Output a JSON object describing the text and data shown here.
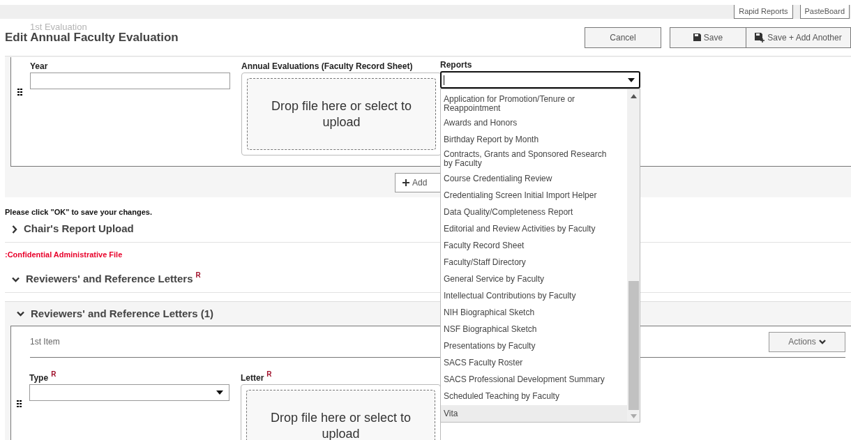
{
  "top_bar": {
    "buttons": [
      "Rapid Reports",
      "PasteBoard"
    ]
  },
  "header": {
    "behind_title": "1st Evaluation",
    "title": "Edit Annual Faculty Evaluation",
    "buttons": [
      {
        "label": "Cancel",
        "kind": "plain"
      },
      {
        "label": "Save",
        "kind": "save"
      },
      {
        "label": "Save + Add Another",
        "kind": "save-add"
      }
    ]
  },
  "evaluation": {
    "fields": [
      {
        "label": "Year",
        "kind": "text"
      },
      {
        "label": "Annual Evaluations (Faculty Record Sheet)",
        "kind": "file",
        "drop_text": "Drop file here or select to upload"
      }
    ],
    "add_button": "Add"
  },
  "reports": {
    "label": "Reports",
    "options": [
      {
        "label": "Application for Promotion/Tenure or Reappointment",
        "selected": false
      },
      {
        "label": "Awards and Honors",
        "selected": false
      },
      {
        "label": "Birthday Report by Month",
        "selected": false
      },
      {
        "label": "Contracts, Grants and Sponsored Research by Faculty",
        "selected": false
      },
      {
        "label": "Course Credentialing Review",
        "selected": false
      },
      {
        "label": "Credentialing Screen Initial Import Helper",
        "selected": false
      },
      {
        "label": "Data Quality/Completeness Report",
        "selected": false
      },
      {
        "label": "Editorial and Review Activities by Faculty",
        "selected": false
      },
      {
        "label": "Faculty Record Sheet",
        "selected": false
      },
      {
        "label": "Faculty/Staff Directory",
        "selected": false
      },
      {
        "label": "General Service by Faculty",
        "selected": false
      },
      {
        "label": "Intellectual Contributions by Faculty",
        "selected": false
      },
      {
        "label": "NIH Biographical Sketch",
        "selected": false
      },
      {
        "label": "NSF Biographical Sketch",
        "selected": false
      },
      {
        "label": "Presentations by Faculty",
        "selected": false
      },
      {
        "label": "SACS Faculty Roster",
        "selected": false
      },
      {
        "label": "SACS Professional Development Summary",
        "selected": false
      },
      {
        "label": "Scheduled Teaching by Faculty",
        "selected": false
      },
      {
        "label": "Vita",
        "selected": true
      }
    ]
  },
  "notice": "Please click \"OK\" to save your changes.",
  "sections": [
    {
      "title": "Chair's Report Upload",
      "expanded": false
    },
    {
      "title": ":Confidential Administrative File",
      "kind": "warning"
    },
    {
      "title": "Reviewers' and Reference Letters",
      "required_mark": "R",
      "expanded": true
    }
  ],
  "letters": {
    "title": "Reviewers' and Reference Letters (1)",
    "expanded": true,
    "item_title": "1st Item",
    "actions": "Actions",
    "fields": [
      {
        "label": "Type",
        "required_mark": "R",
        "kind": "select"
      },
      {
        "label": "Letter",
        "required_mark": "R",
        "kind": "file",
        "drop_text": "Drop file here or select to upload"
      }
    ]
  }
}
